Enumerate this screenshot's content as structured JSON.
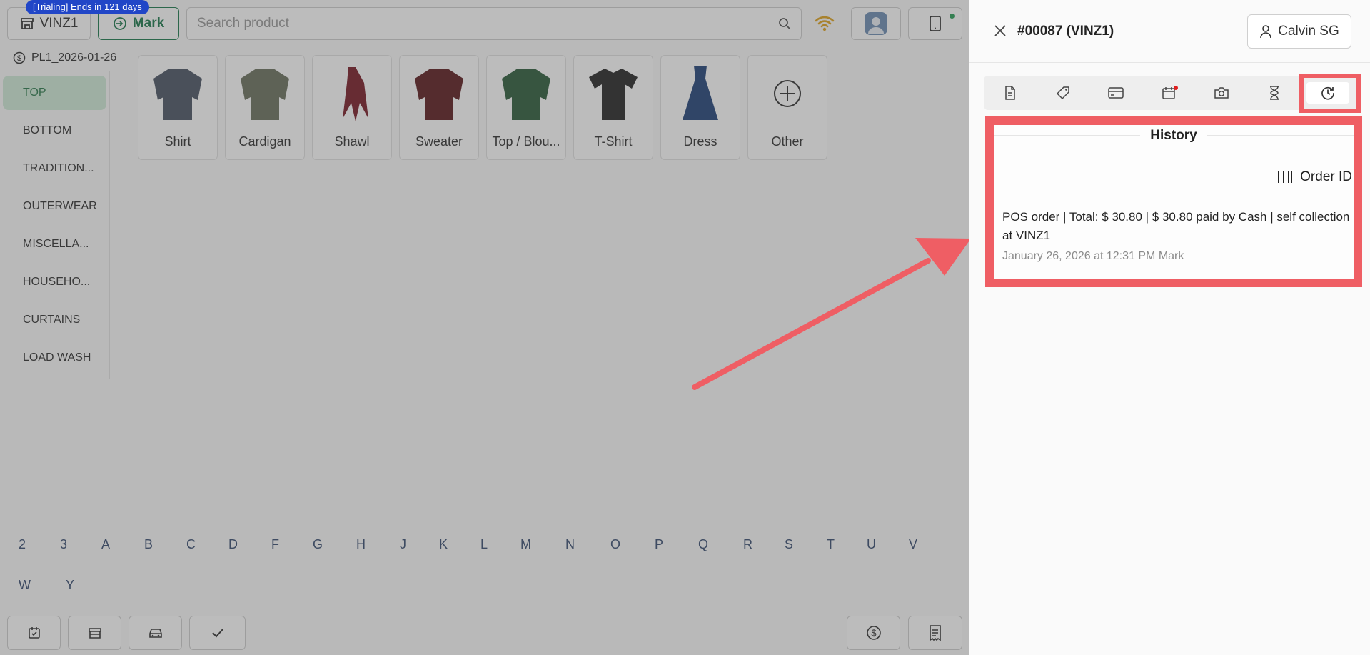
{
  "topbar": {
    "trial_badge": "[Trialing] Ends in 121 days",
    "store_label": "VINZ1",
    "mark_label": "Mark",
    "search_placeholder": "Search product"
  },
  "pricelist": "PL1_2026-01-26",
  "categories": [
    {
      "label": "TOP",
      "active": true
    },
    {
      "label": "BOTTOM",
      "active": false
    },
    {
      "label": "TRADITION...",
      "active": false
    },
    {
      "label": "OUTERWEAR",
      "active": false
    },
    {
      "label": "MISCELLA...",
      "active": false
    },
    {
      "label": "HOUSEHO...",
      "active": false
    },
    {
      "label": "CURTAINS",
      "active": false
    },
    {
      "label": "LOAD WASH",
      "active": false
    }
  ],
  "products": [
    {
      "label": "Shirt",
      "icon": "shirt-icon",
      "color": "#4d5666"
    },
    {
      "label": "Cardigan",
      "icon": "cardigan-icon",
      "color": "#6d7260"
    },
    {
      "label": "Shawl",
      "icon": "shawl-icon",
      "color": "#7a1f2a"
    },
    {
      "label": "Sweater",
      "icon": "sweater-icon",
      "color": "#5e1f22"
    },
    {
      "label": "Top / Blou...",
      "icon": "blouse-icon",
      "color": "#2f5e3e"
    },
    {
      "label": "T-Shirt",
      "icon": "tshirt-icon",
      "color": "#2a2a2a"
    },
    {
      "label": "Dress",
      "icon": "dress-icon",
      "color": "#24457a"
    },
    {
      "label": "Other",
      "icon": "plus-circle-icon",
      "color": "#333333"
    }
  ],
  "alphabet_row1": [
    "2",
    "3",
    "A",
    "B",
    "C",
    "D",
    "F",
    "G",
    "H",
    "J",
    "K",
    "L",
    "M",
    "N",
    "O",
    "P",
    "Q",
    "R",
    "S",
    "T",
    "U",
    "V"
  ],
  "alphabet_row2": [
    "W",
    "Y"
  ],
  "panel": {
    "order_title": "#00087 (VINZ1)",
    "customer_label": "Calvin SG",
    "tabs": [
      "document-icon",
      "tag-icon",
      "card-icon",
      "calendar-icon",
      "camera-icon",
      "hourglass-icon",
      "history-icon"
    ],
    "active_tab": "history-icon"
  },
  "history": {
    "title": "History",
    "order_id_label": "Order ID",
    "entry_text": "POS order | Total: $ 30.80 | $ 30.80 paid by Cash | self collection at VINZ1",
    "entry_meta": "January 26, 2026 at 12:31 PM Mark"
  },
  "colors": {
    "accent_green": "#1f7a4f",
    "highlight_red": "#ef5e64",
    "trial_blue": "#2146c7"
  }
}
